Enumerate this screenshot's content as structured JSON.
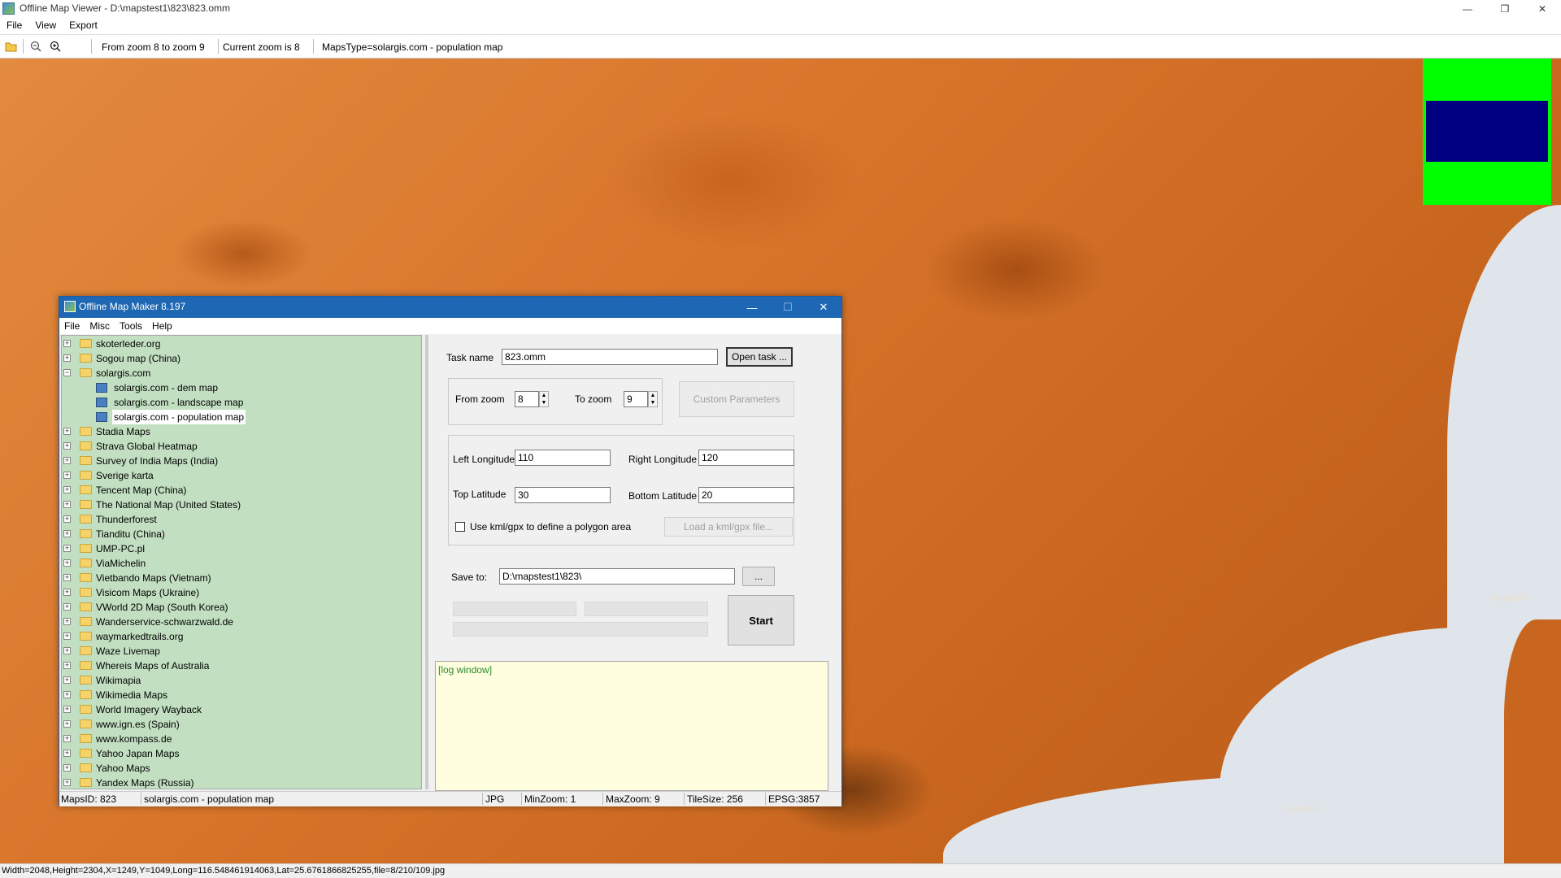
{
  "window": {
    "title": "Offline Map Viewer - D:\\mapstest1\\823\\823.omm",
    "min_btn": "—",
    "max_btn": "❐",
    "close_btn": "✕"
  },
  "menu": [
    "File",
    "View",
    "Export"
  ],
  "toolbar": {
    "zoom_range": "From zoom 8 to zoom 9",
    "current_zoom": "Current zoom is 8",
    "maps_type": "MapsType=solargis.com - population map"
  },
  "map": {
    "watermark": "SolarGIS",
    "minimap_colors": {
      "background": "#00ff00",
      "viewport": "#000080"
    }
  },
  "statusbar": {
    "text": "Width=2048,Height=2304,X=1249,Y=1049,Long=116.548461914063,Lat=25.6761866825255,file=8/210/109.jpg"
  },
  "dialog": {
    "title": "Offline Map Maker 8.197",
    "min_btn": "—",
    "max_btn": "☐",
    "close_btn": "✕",
    "menu": [
      "File",
      "Misc",
      "Tools",
      "Help"
    ],
    "tree": [
      {
        "label": "skoterleder.org",
        "level": 0,
        "expander": "+"
      },
      {
        "label": "Sogou map (China)",
        "level": 0,
        "expander": "+"
      },
      {
        "label": "solargis.com",
        "level": 0,
        "expander": "−"
      },
      {
        "label": "solargis.com - dem map",
        "level": 1
      },
      {
        "label": "solargis.com - landscape map",
        "level": 1
      },
      {
        "label": "solargis.com - population map",
        "level": 1,
        "selected": true
      },
      {
        "label": "Stadia Maps",
        "level": 0,
        "expander": "+"
      },
      {
        "label": "Strava Global Heatmap",
        "level": 0,
        "expander": "+"
      },
      {
        "label": "Survey of India Maps (India)",
        "level": 0,
        "expander": "+"
      },
      {
        "label": "Sverige karta",
        "level": 0,
        "expander": "+"
      },
      {
        "label": "Tencent Map (China)",
        "level": 0,
        "expander": "+"
      },
      {
        "label": "The National Map (United States)",
        "level": 0,
        "expander": "+"
      },
      {
        "label": "Thunderforest",
        "level": 0,
        "expander": "+"
      },
      {
        "label": "Tianditu (China)",
        "level": 0,
        "expander": "+"
      },
      {
        "label": "UMP-PC.pl",
        "level": 0,
        "expander": "+"
      },
      {
        "label": "ViaMichelin",
        "level": 0,
        "expander": "+"
      },
      {
        "label": "Vietbando Maps (Vietnam)",
        "level": 0,
        "expander": "+"
      },
      {
        "label": "Visicom Maps (Ukraine)",
        "level": 0,
        "expander": "+"
      },
      {
        "label": "VWorld 2D Map (South Korea)",
        "level": 0,
        "expander": "+"
      },
      {
        "label": "Wanderservice-schwarzwald.de",
        "level": 0,
        "expander": "+"
      },
      {
        "label": "waymarkedtrails.org",
        "level": 0,
        "expander": "+"
      },
      {
        "label": "Waze Livemap",
        "level": 0,
        "expander": "+"
      },
      {
        "label": "Whereis Maps of Australia",
        "level": 0,
        "expander": "+"
      },
      {
        "label": "Wikimapia",
        "level": 0,
        "expander": "+"
      },
      {
        "label": "Wikimedia Maps",
        "level": 0,
        "expander": "+"
      },
      {
        "label": "World Imagery Wayback",
        "level": 0,
        "expander": "+"
      },
      {
        "label": "www.ign.es (Spain)",
        "level": 0,
        "expander": "+"
      },
      {
        "label": "www.kompass.de",
        "level": 0,
        "expander": "+"
      },
      {
        "label": "Yahoo Japan Maps",
        "level": 0,
        "expander": "+"
      },
      {
        "label": "Yahoo Maps",
        "level": 0,
        "expander": "+"
      },
      {
        "label": "Yandex Maps (Russia)",
        "level": 0,
        "expander": "+"
      }
    ],
    "form": {
      "task_name_label": "Task name",
      "task_name_value": "823.omm",
      "open_task_button": "Open task ...",
      "from_zoom_label": "From zoom",
      "from_zoom_value": "8",
      "to_zoom_label": "To zoom",
      "to_zoom_value": "9",
      "custom_params_button": "Custom Parameters",
      "left_lon_label": "Left Longitude",
      "left_lon_value": "110",
      "right_lon_label": "Right Longitude",
      "right_lon_value": "120",
      "top_lat_label": "Top Latitude",
      "top_lat_value": "30",
      "bottom_lat_label": "Bottom Latitude",
      "bottom_lat_value": "20",
      "kml_checkbox_label": "Use kml/gpx to define a polygon area",
      "kml_checked": false,
      "load_kml_button": "Load a kml/gpx file...",
      "save_to_label": "Save to:",
      "save_to_value": "D:\\mapstest1\\823\\",
      "browse_button": "...",
      "start_button": "Start"
    },
    "log_text": "[log window]",
    "status": {
      "maps_id": "MapsID: 823",
      "maps_name": "solargis.com - population map",
      "format": "JPG",
      "min_zoom": "MinZoom: 1",
      "max_zoom": "MaxZoom: 9",
      "tile_size": "TileSize: 256",
      "epsg": "EPSG:3857"
    }
  }
}
